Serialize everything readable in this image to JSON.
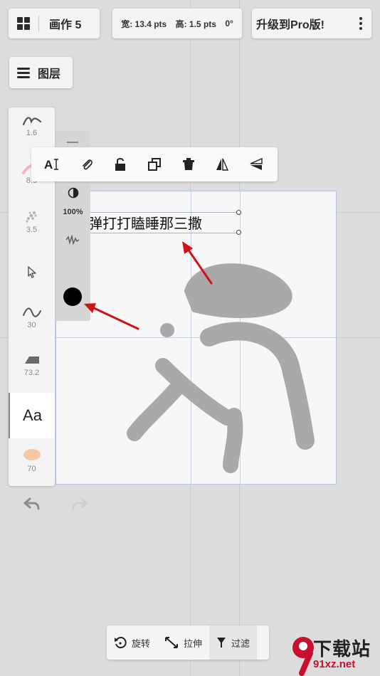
{
  "header": {
    "doc_title": "画作 5",
    "size_readout": {
      "width": "宽: 13.4 pts",
      "height": "高: 1.5 pts",
      "angle": "0°"
    },
    "upgrade_label": "升级到Pro版!"
  },
  "layers": {
    "label": "图层"
  },
  "tools": {
    "items": [
      {
        "name": "pencil",
        "value": "1.6"
      },
      {
        "name": "airbrush",
        "value": "8.9"
      },
      {
        "name": "spray",
        "value": "3.5"
      },
      {
        "name": "select",
        "value": ""
      },
      {
        "name": "curve",
        "value": "30"
      },
      {
        "name": "eraser",
        "value": "73.2"
      },
      {
        "name": "text",
        "label": "Aa"
      },
      {
        "name": "smudge",
        "value": "70"
      }
    ]
  },
  "sub_column": {
    "opacity": "100%",
    "color": "#000000"
  },
  "canvas": {
    "text_content": "弹打打瞌睡那三撒"
  },
  "bottom_bar": {
    "rotate": "旋转",
    "stretch": "拉伸",
    "filter": "过滤"
  },
  "watermark": {
    "line1": "下载站",
    "line2": "91xz.net"
  },
  "colors": {
    "accent_red": "#d0121b",
    "panel": "#f4f4f4",
    "stroke_gray": "#a9a9a9"
  }
}
